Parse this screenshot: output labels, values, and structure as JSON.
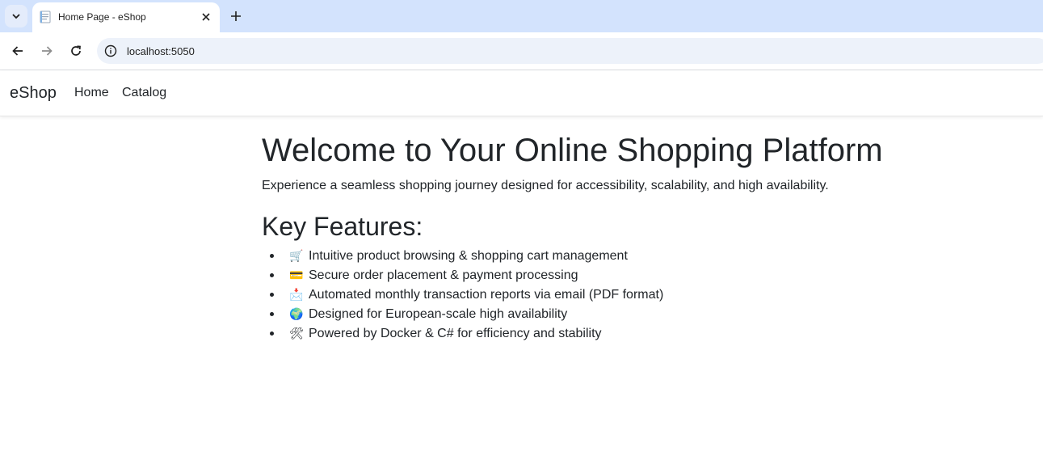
{
  "browser": {
    "tab_title": "Home Page - eShop",
    "url": "localhost:5050",
    "new_tab_symbol": "+",
    "close_symbol": "✕"
  },
  "navbar": {
    "brand": "eShop",
    "links": [
      "Home",
      "Catalog"
    ]
  },
  "main": {
    "title": "Welcome to Your Online Shopping Platform",
    "subtitle": "Experience a seamless shopping journey designed for accessibility, scalability, and high availability.",
    "features_title": "Key Features:",
    "features": [
      {
        "icon": "🛒",
        "icon_name": "shopping-cart-icon",
        "text": "Intuitive product browsing & shopping cart management"
      },
      {
        "icon": "💳",
        "icon_name": "credit-card-icon",
        "text": "Secure order placement & payment processing"
      },
      {
        "icon": "📩",
        "icon_name": "envelope-icon",
        "text": "Automated monthly transaction reports via email (PDF format)"
      },
      {
        "icon": "🌍",
        "icon_name": "globe-icon",
        "text": "Designed for European-scale high availability"
      },
      {
        "icon": "🛠",
        "icon_name": "tools-icon",
        "text": "Powered by Docker & C# for efficiency and stability"
      }
    ]
  },
  "colors": {
    "tabstrip": "#d3e3fd",
    "omnibox": "#edf2fa",
    "text": "#212529"
  }
}
